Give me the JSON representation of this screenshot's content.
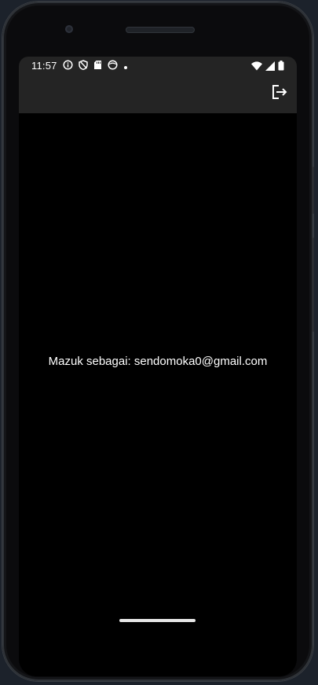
{
  "status_bar": {
    "time": "11:57",
    "left_icons": [
      "info-icon",
      "shield-icon",
      "sd-card-icon",
      "face-icon",
      "dot-icon"
    ],
    "right_icons": [
      "wifi-icon",
      "signal-icon",
      "battery-icon"
    ]
  },
  "app_bar": {
    "action_icon": "logout-icon"
  },
  "main": {
    "logged_in_text": "Mazuk sebagai: sendomoka0@gmail.com"
  },
  "colors": {
    "background": "#000000",
    "app_bar": "#242424",
    "text": "#ffffff"
  }
}
